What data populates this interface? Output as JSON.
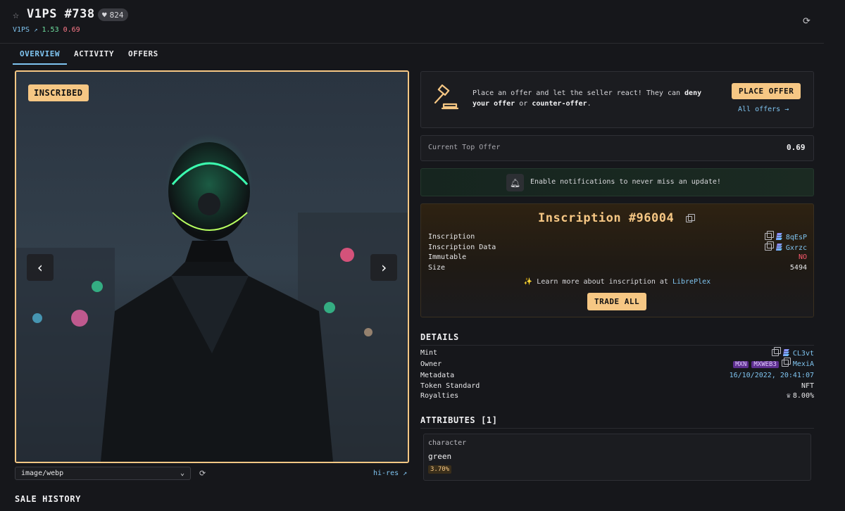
{
  "header": {
    "title": "V1PS #738",
    "likes": "824",
    "collection": "V1PS",
    "price_green": "1.53",
    "price_red": "0.69"
  },
  "tabs": [
    {
      "label": "OVERVIEW",
      "active": true
    },
    {
      "label": "ACTIVITY",
      "active": false
    },
    {
      "label": "OFFERS",
      "active": false
    }
  ],
  "media": {
    "badge": "INSCRIBED",
    "format": "image/webp",
    "hires_label": "hi-res"
  },
  "offer": {
    "text_pre": "Place an offer and let the seller react! They can ",
    "text_b1": "deny your offer",
    "text_mid": " or ",
    "text_b2": "counter-offer",
    "text_post": ".",
    "button": "PLACE OFFER",
    "all_offers": "All offers →"
  },
  "top_offer": {
    "label": "Current Top Offer",
    "value": "0.69"
  },
  "notification": {
    "text": "Enable notifications to never miss an update!"
  },
  "inscription": {
    "title": "Inscription #96004",
    "rows": [
      {
        "label": "Inscription",
        "value": "8qEsP"
      },
      {
        "label": "Inscription Data",
        "value": "Gxrzc"
      },
      {
        "label": "Immutable",
        "value": "NO"
      },
      {
        "label": "Size",
        "value": "5494"
      }
    ],
    "learn_pre": "✨ Learn more about inscription at ",
    "learn_link": "LibrePlex",
    "trade_all": "TRADE ALL"
  },
  "details": {
    "title": "DETAILS",
    "rows": [
      {
        "label": "Mint",
        "value": "CL3vt"
      },
      {
        "label": "Owner",
        "tags": [
          "MXN",
          "MXWEB3"
        ],
        "value": "MexiA"
      },
      {
        "label": "Metadata",
        "value": "16/10/2022, 20:41:07"
      },
      {
        "label": "Token Standard",
        "value": "NFT"
      },
      {
        "label": "Royalties",
        "value": "8.00%"
      }
    ]
  },
  "attributes": {
    "title": "ATTRIBUTES [1]",
    "items": [
      {
        "type": "character",
        "value": "green",
        "pct": "3.70%"
      }
    ]
  },
  "sale_history": {
    "title": "SALE HISTORY"
  }
}
